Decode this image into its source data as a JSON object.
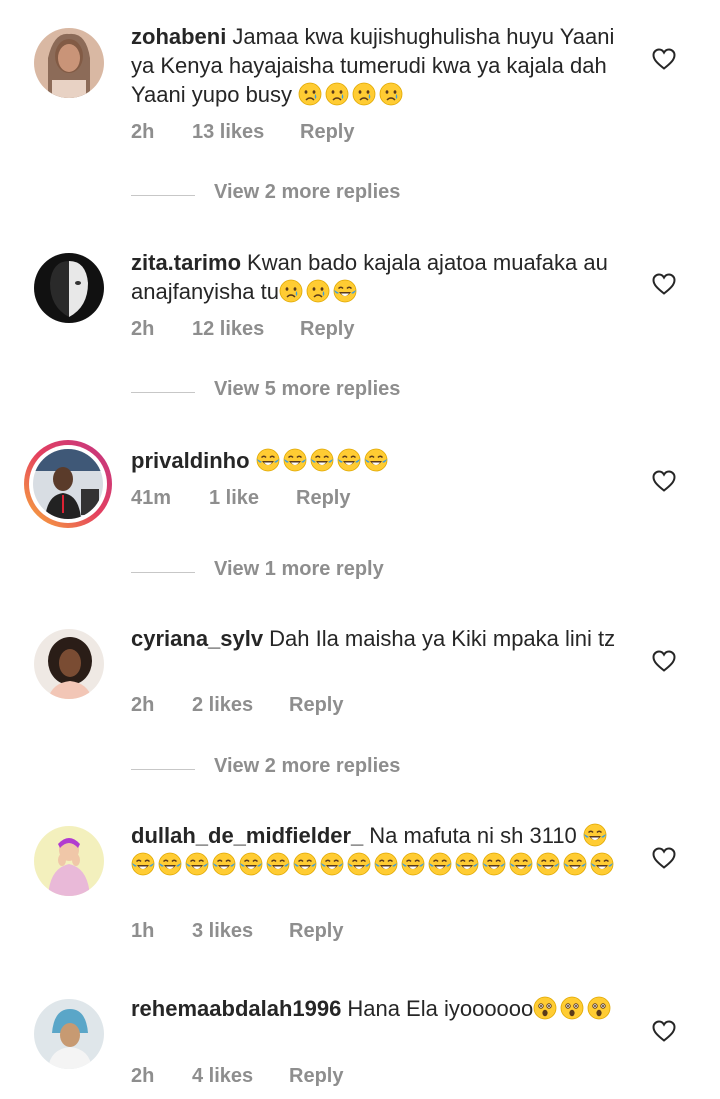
{
  "comments": [
    {
      "username": "zohabeni",
      "text": "Jamaa kwa kujishughulisha huyu Yaani ya Kenya hayajaisha tumerudi kwa ya kajala dah Yaani yupo busy",
      "emojis": [
        "crying-face-icon",
        "crying-face-icon",
        "crying-face-icon",
        "crying-face-icon"
      ],
      "time": "2h",
      "likes": "13 likes",
      "reply": "Reply",
      "view_more": "View 2 more replies"
    },
    {
      "username": "zita.tarimo",
      "text": "Kwan bado kajala ajatoa muafaka au anajfanyisha tu",
      "emojis": [
        "crying-face-icon",
        "crying-face-icon",
        "joy-face-icon"
      ],
      "time": "2h",
      "likes": "12 likes",
      "reply": "Reply",
      "view_more": "View 5 more replies"
    },
    {
      "username": "privaldinho",
      "text": "",
      "emojis": [
        "joy-face-icon",
        "joy-face-icon",
        "joy-face-icon",
        "joy-face-icon",
        "joy-face-icon"
      ],
      "time": "41m",
      "likes": "1 like",
      "reply": "Reply",
      "view_more": "View 1 more reply"
    },
    {
      "username": "cyriana_sylv",
      "text": "Dah Ila maisha ya Kiki mpaka lini tz",
      "emojis": [],
      "time": "2h",
      "likes": "2 likes",
      "reply": "Reply",
      "view_more": "View 2 more replies"
    },
    {
      "username": "dullah_de_midfielder_",
      "text": "Na mafuta ni sh  3110",
      "emojis": [
        "joy-face-icon",
        "joy-face-icon",
        "joy-face-icon",
        "joy-face-icon",
        "joy-face-icon",
        "joy-face-icon",
        "joy-face-icon",
        "joy-face-icon",
        "joy-face-icon",
        "joy-face-icon",
        "joy-face-icon",
        "joy-face-icon",
        "joy-face-icon",
        "joy-face-icon",
        "joy-face-icon",
        "joy-face-icon",
        "joy-face-icon",
        "joy-face-icon",
        "joy-face-icon"
      ],
      "time": "1h",
      "likes": "3 likes",
      "reply": "Reply"
    },
    {
      "username": "rehemaabdalah1996",
      "text": "Hana Ela iyoooooo",
      "emojis": [
        "astonished-face-icon",
        "astonished-face-icon",
        "astonished-face-icon"
      ],
      "time": "2h",
      "likes": "4 likes",
      "reply": "Reply"
    }
  ],
  "colors": {
    "text": "#262626",
    "muted": "#8e8e8e",
    "emoji_yellow": "#ffcc33",
    "tear_blue": "#3b9de0"
  }
}
